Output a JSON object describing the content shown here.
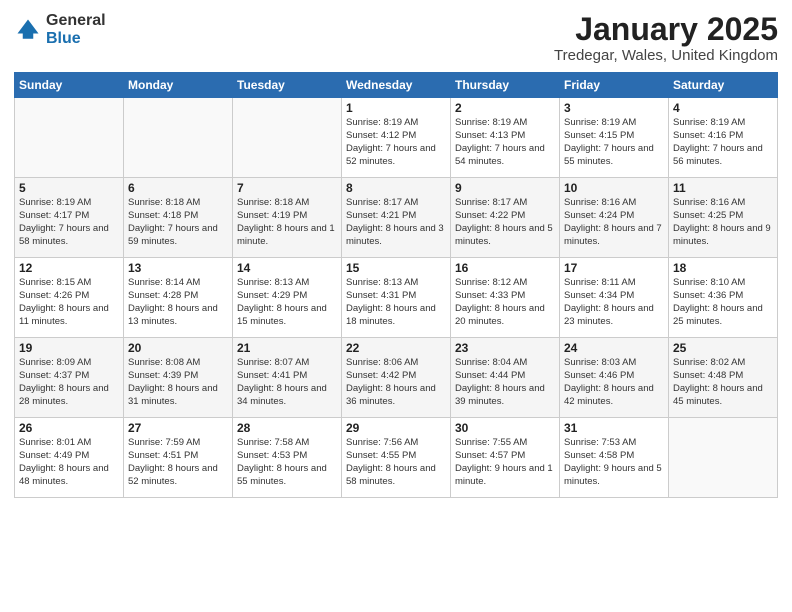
{
  "header": {
    "logo_general": "General",
    "logo_blue": "Blue",
    "month_title": "January 2025",
    "location": "Tredegar, Wales, United Kingdom"
  },
  "days_of_week": [
    "Sunday",
    "Monday",
    "Tuesday",
    "Wednesday",
    "Thursday",
    "Friday",
    "Saturday"
  ],
  "weeks": [
    [
      {
        "num": "",
        "info": ""
      },
      {
        "num": "",
        "info": ""
      },
      {
        "num": "",
        "info": ""
      },
      {
        "num": "1",
        "info": "Sunrise: 8:19 AM\nSunset: 4:12 PM\nDaylight: 7 hours\nand 52 minutes."
      },
      {
        "num": "2",
        "info": "Sunrise: 8:19 AM\nSunset: 4:13 PM\nDaylight: 7 hours\nand 54 minutes."
      },
      {
        "num": "3",
        "info": "Sunrise: 8:19 AM\nSunset: 4:15 PM\nDaylight: 7 hours\nand 55 minutes."
      },
      {
        "num": "4",
        "info": "Sunrise: 8:19 AM\nSunset: 4:16 PM\nDaylight: 7 hours\nand 56 minutes."
      }
    ],
    [
      {
        "num": "5",
        "info": "Sunrise: 8:19 AM\nSunset: 4:17 PM\nDaylight: 7 hours\nand 58 minutes."
      },
      {
        "num": "6",
        "info": "Sunrise: 8:18 AM\nSunset: 4:18 PM\nDaylight: 7 hours\nand 59 minutes."
      },
      {
        "num": "7",
        "info": "Sunrise: 8:18 AM\nSunset: 4:19 PM\nDaylight: 8 hours\nand 1 minute."
      },
      {
        "num": "8",
        "info": "Sunrise: 8:17 AM\nSunset: 4:21 PM\nDaylight: 8 hours\nand 3 minutes."
      },
      {
        "num": "9",
        "info": "Sunrise: 8:17 AM\nSunset: 4:22 PM\nDaylight: 8 hours\nand 5 minutes."
      },
      {
        "num": "10",
        "info": "Sunrise: 8:16 AM\nSunset: 4:24 PM\nDaylight: 8 hours\nand 7 minutes."
      },
      {
        "num": "11",
        "info": "Sunrise: 8:16 AM\nSunset: 4:25 PM\nDaylight: 8 hours\nand 9 minutes."
      }
    ],
    [
      {
        "num": "12",
        "info": "Sunrise: 8:15 AM\nSunset: 4:26 PM\nDaylight: 8 hours\nand 11 minutes."
      },
      {
        "num": "13",
        "info": "Sunrise: 8:14 AM\nSunset: 4:28 PM\nDaylight: 8 hours\nand 13 minutes."
      },
      {
        "num": "14",
        "info": "Sunrise: 8:13 AM\nSunset: 4:29 PM\nDaylight: 8 hours\nand 15 minutes."
      },
      {
        "num": "15",
        "info": "Sunrise: 8:13 AM\nSunset: 4:31 PM\nDaylight: 8 hours\nand 18 minutes."
      },
      {
        "num": "16",
        "info": "Sunrise: 8:12 AM\nSunset: 4:33 PM\nDaylight: 8 hours\nand 20 minutes."
      },
      {
        "num": "17",
        "info": "Sunrise: 8:11 AM\nSunset: 4:34 PM\nDaylight: 8 hours\nand 23 minutes."
      },
      {
        "num": "18",
        "info": "Sunrise: 8:10 AM\nSunset: 4:36 PM\nDaylight: 8 hours\nand 25 minutes."
      }
    ],
    [
      {
        "num": "19",
        "info": "Sunrise: 8:09 AM\nSunset: 4:37 PM\nDaylight: 8 hours\nand 28 minutes."
      },
      {
        "num": "20",
        "info": "Sunrise: 8:08 AM\nSunset: 4:39 PM\nDaylight: 8 hours\nand 31 minutes."
      },
      {
        "num": "21",
        "info": "Sunrise: 8:07 AM\nSunset: 4:41 PM\nDaylight: 8 hours\nand 34 minutes."
      },
      {
        "num": "22",
        "info": "Sunrise: 8:06 AM\nSunset: 4:42 PM\nDaylight: 8 hours\nand 36 minutes."
      },
      {
        "num": "23",
        "info": "Sunrise: 8:04 AM\nSunset: 4:44 PM\nDaylight: 8 hours\nand 39 minutes."
      },
      {
        "num": "24",
        "info": "Sunrise: 8:03 AM\nSunset: 4:46 PM\nDaylight: 8 hours\nand 42 minutes."
      },
      {
        "num": "25",
        "info": "Sunrise: 8:02 AM\nSunset: 4:48 PM\nDaylight: 8 hours\nand 45 minutes."
      }
    ],
    [
      {
        "num": "26",
        "info": "Sunrise: 8:01 AM\nSunset: 4:49 PM\nDaylight: 8 hours\nand 48 minutes."
      },
      {
        "num": "27",
        "info": "Sunrise: 7:59 AM\nSunset: 4:51 PM\nDaylight: 8 hours\nand 52 minutes."
      },
      {
        "num": "28",
        "info": "Sunrise: 7:58 AM\nSunset: 4:53 PM\nDaylight: 8 hours\nand 55 minutes."
      },
      {
        "num": "29",
        "info": "Sunrise: 7:56 AM\nSunset: 4:55 PM\nDaylight: 8 hours\nand 58 minutes."
      },
      {
        "num": "30",
        "info": "Sunrise: 7:55 AM\nSunset: 4:57 PM\nDaylight: 9 hours\nand 1 minute."
      },
      {
        "num": "31",
        "info": "Sunrise: 7:53 AM\nSunset: 4:58 PM\nDaylight: 9 hours\nand 5 minutes."
      },
      {
        "num": "",
        "info": ""
      }
    ]
  ]
}
